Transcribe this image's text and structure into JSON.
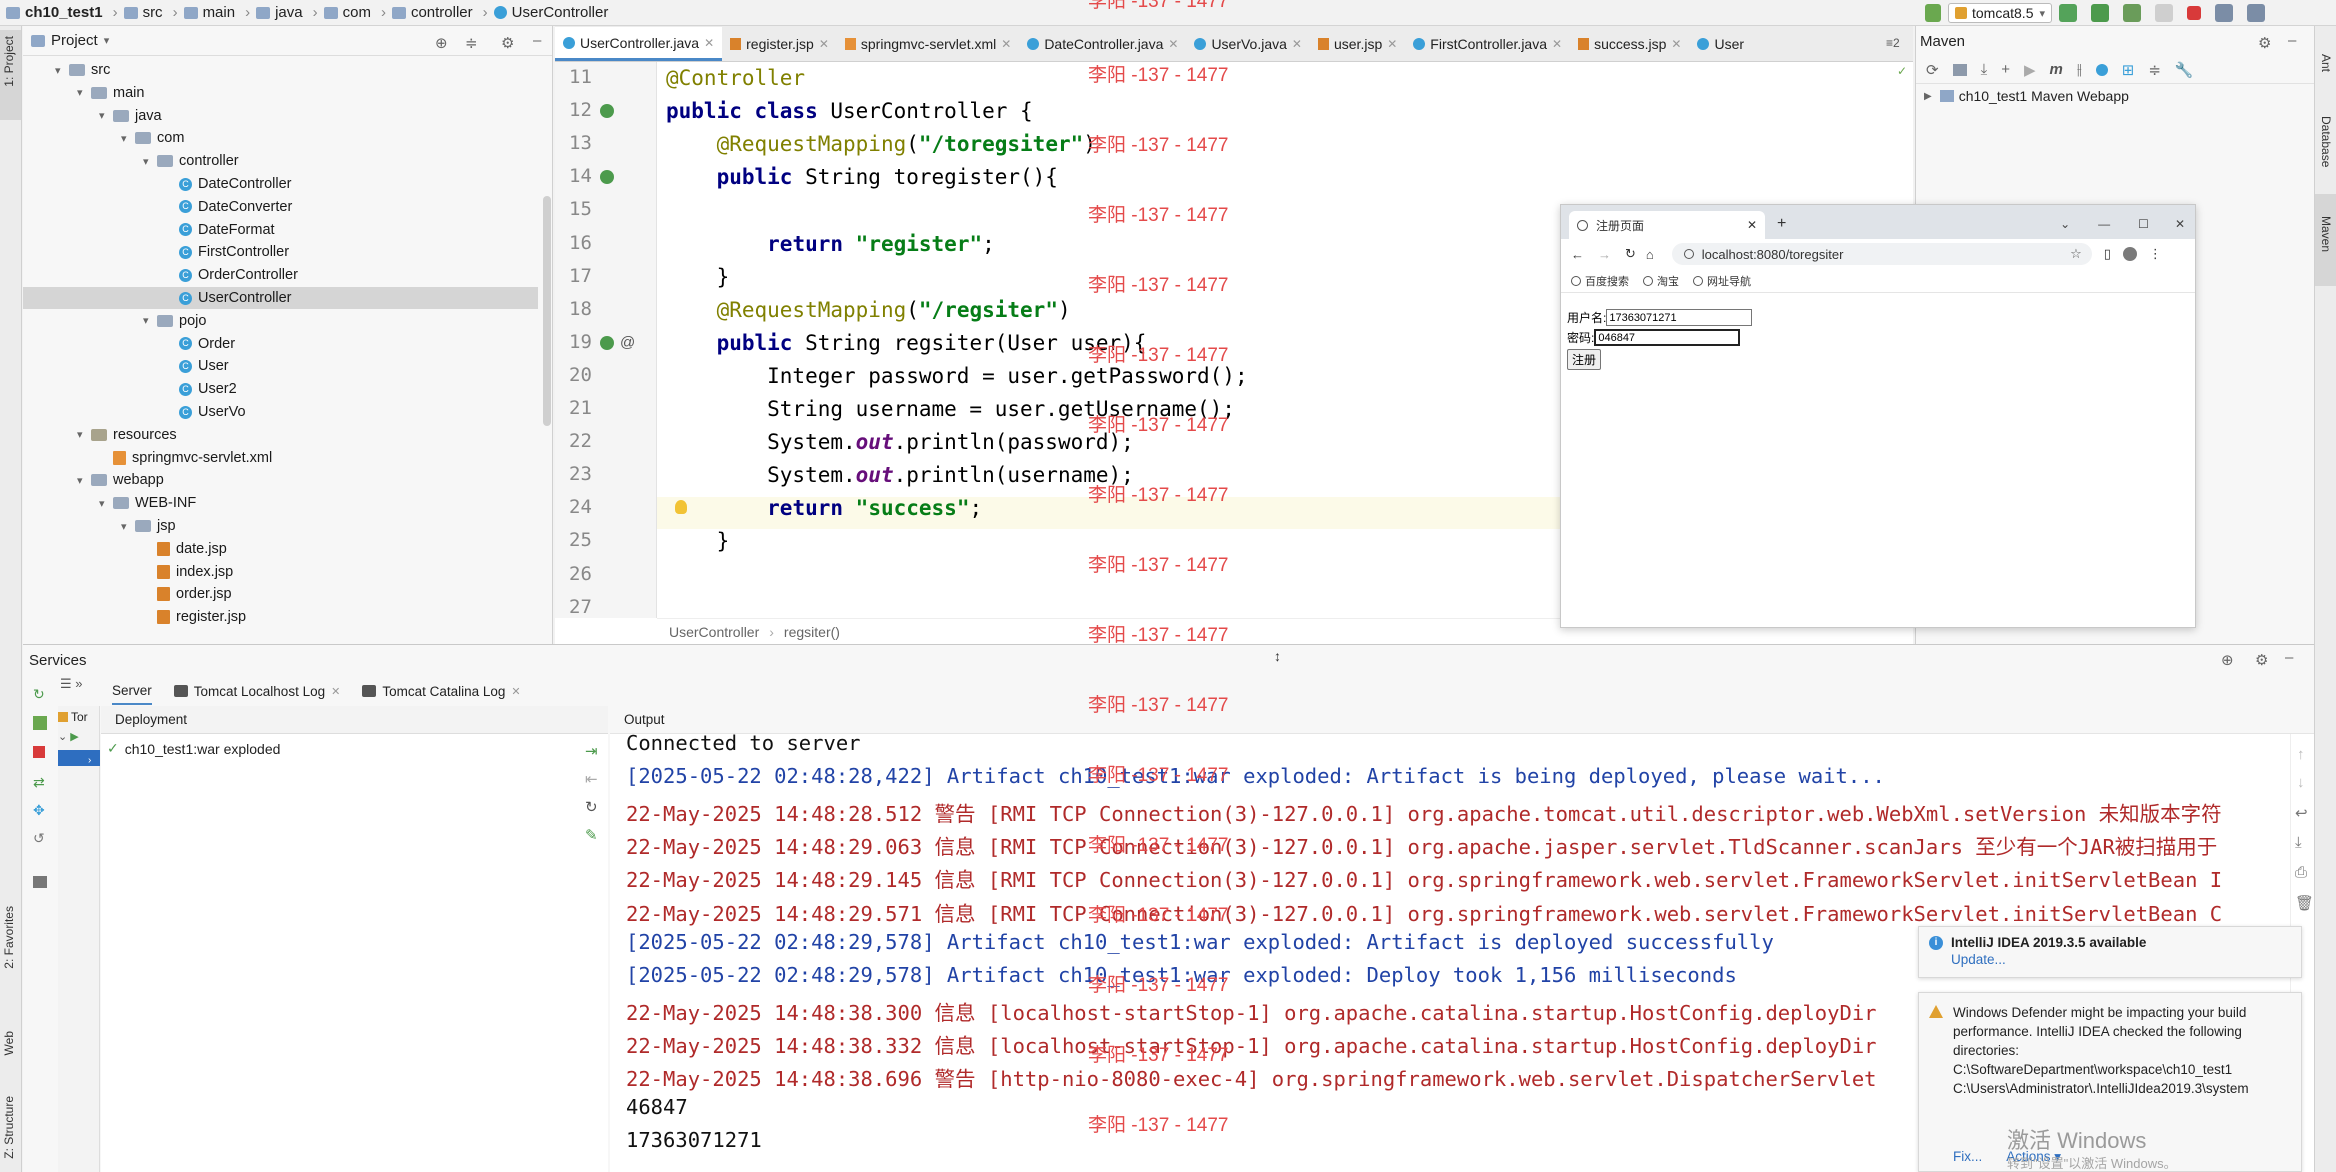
{
  "navbar": {
    "breadcrumbs": [
      "ch10_test1",
      "src",
      "main",
      "java",
      "com",
      "controller",
      "UserController"
    ],
    "run_config": "tomcat8.5"
  },
  "project_panel": {
    "title": "Project",
    "tree": [
      {
        "label": "src",
        "depth": 1,
        "kind": "folder",
        "arrow": "▾"
      },
      {
        "label": "main",
        "depth": 2,
        "kind": "folder",
        "arrow": "▾"
      },
      {
        "label": "java",
        "depth": 3,
        "kind": "folder",
        "arrow": "▾"
      },
      {
        "label": "com",
        "depth": 4,
        "kind": "folder",
        "arrow": "▾"
      },
      {
        "label": "controller",
        "depth": 5,
        "kind": "folder",
        "arrow": "▾"
      },
      {
        "label": "DateController",
        "depth": 6,
        "kind": "class"
      },
      {
        "label": "DateConverter",
        "depth": 6,
        "kind": "class"
      },
      {
        "label": "DateFormat",
        "depth": 6,
        "kind": "class"
      },
      {
        "label": "FirstController",
        "depth": 6,
        "kind": "class"
      },
      {
        "label": "OrderController",
        "depth": 6,
        "kind": "class"
      },
      {
        "label": "UserController",
        "depth": 6,
        "kind": "class",
        "selected": true
      },
      {
        "label": "pojo",
        "depth": 5,
        "kind": "folder",
        "arrow": "▾"
      },
      {
        "label": "Order",
        "depth": 6,
        "kind": "class"
      },
      {
        "label": "User",
        "depth": 6,
        "kind": "class"
      },
      {
        "label": "User2",
        "depth": 6,
        "kind": "class"
      },
      {
        "label": "UserVo",
        "depth": 6,
        "kind": "class"
      },
      {
        "label": "resources",
        "depth": 2,
        "kind": "folder-res",
        "arrow": "▾"
      },
      {
        "label": "springmvc-servlet.xml",
        "depth": 3,
        "kind": "xml"
      },
      {
        "label": "webapp",
        "depth": 2,
        "kind": "folder",
        "arrow": "▾"
      },
      {
        "label": "WEB-INF",
        "depth": 3,
        "kind": "folder",
        "arrow": "▾"
      },
      {
        "label": "jsp",
        "depth": 4,
        "kind": "folder",
        "arrow": "▾"
      },
      {
        "label": "date.jsp",
        "depth": 5,
        "kind": "jsp"
      },
      {
        "label": "index.jsp",
        "depth": 5,
        "kind": "jsp"
      },
      {
        "label": "order.jsp",
        "depth": 5,
        "kind": "jsp"
      },
      {
        "label": "register.jsp",
        "depth": 5,
        "kind": "jsp"
      }
    ]
  },
  "editor": {
    "tabs": [
      {
        "label": "UserController.java",
        "icon": "class",
        "active": true
      },
      {
        "label": "register.jsp",
        "icon": "jsp"
      },
      {
        "label": "springmvc-servlet.xml",
        "icon": "xml"
      },
      {
        "label": "DateController.java",
        "icon": "class"
      },
      {
        "label": "UserVo.java",
        "icon": "class"
      },
      {
        "label": "user.jsp",
        "icon": "jsp"
      },
      {
        "label": "FirstController.java",
        "icon": "class"
      },
      {
        "label": "success.jsp",
        "icon": "jsp"
      },
      {
        "label": "User",
        "icon": "class"
      }
    ],
    "tab_overflow": "≡2",
    "lines": [
      {
        "num": "11",
        "html": "<span class='ann'>@Controller</span>"
      },
      {
        "num": "12",
        "html": "<span class='kw'>public class</span> UserController {"
      },
      {
        "num": "13",
        "html": "    <span class='ann'>@RequestMapping</span>(<span class='str'>\"/toregsiter\"</span>)"
      },
      {
        "num": "14",
        "html": "    <span class='kw'>public</span> String toregister(){"
      },
      {
        "num": "15",
        "html": ""
      },
      {
        "num": "16",
        "html": "        <span class='kw'>return</span> <span class='str'>\"register\"</span>;"
      },
      {
        "num": "17",
        "html": "    }"
      },
      {
        "num": "18",
        "html": "    <span class='ann'>@RequestMapping</span>(<span class='str'>\"/regsiter\"</span>)"
      },
      {
        "num": "19",
        "html": "    <span class='kw'>public</span> String regsiter(User user){"
      },
      {
        "num": "20",
        "html": "        Integer password = user.getPassword();"
      },
      {
        "num": "21",
        "html": "        String username = user.getUsername();"
      },
      {
        "num": "22",
        "html": "        System.<span class='ital'>out</span>.println(password);"
      },
      {
        "num": "23",
        "html": "        System.<span class='ital'>out</span>.println(username);"
      },
      {
        "num": "24",
        "html": "        <span class='kw'>return</span> <span class='str'>\"success\"</span>;"
      },
      {
        "num": "25",
        "html": "    }"
      },
      {
        "num": "26",
        "html": ""
      },
      {
        "num": "27",
        "html": ""
      }
    ],
    "footer_breadcrumb": [
      "UserController",
      "regsiter()"
    ]
  },
  "maven": {
    "title": "Maven",
    "project": "ch10_test1 Maven Webapp"
  },
  "browser": {
    "tab_title": "注册页面",
    "url": "localhost:8080/toregsiter",
    "bookmarks": [
      "百度搜索",
      "淘宝",
      "网址导航"
    ],
    "username_label": "用户名:",
    "username_value": "17363071271",
    "password_label": "密码:",
    "password_value": "046847",
    "submit_label": "注册"
  },
  "services": {
    "title": "Services",
    "tabs": [
      "Server",
      "Tomcat Localhost Log",
      "Tomcat Catalina Log"
    ],
    "tree_root": "Tor",
    "deployment_header": "Deployment",
    "deployment_item": "ch10_test1:war exploded",
    "output_header": "Output",
    "output_lines": [
      {
        "text": "Connected to server",
        "style": "plain"
      },
      {
        "text": "[2025-05-22 02:48:28,422] Artifact ch10_test1:war exploded: Artifact is being deployed, please wait...",
        "style": "blue"
      },
      {
        "text": "22-May-2025 14:48:28.512 警告 [RMI TCP Connection(3)-127.0.0.1] org.apache.tomcat.util.descriptor.web.WebXml.setVersion 未知版本字符",
        "style": "red"
      },
      {
        "text": "22-May-2025 14:48:29.063 信息 [RMI TCP Connection(3)-127.0.0.1] org.apache.jasper.servlet.TldScanner.scanJars 至少有一个JAR被扫描用于",
        "style": "red"
      },
      {
        "text": "22-May-2025 14:48:29.145 信息 [RMI TCP Connection(3)-127.0.0.1] org.springframework.web.servlet.FrameworkServlet.initServletBean I",
        "style": "red"
      },
      {
        "text": "22-May-2025 14:48:29.571 信息 [RMI TCP Connection(3)-127.0.0.1] org.springframework.web.servlet.FrameworkServlet.initServletBean C",
        "style": "red"
      },
      {
        "text": "[2025-05-22 02:48:29,578] Artifact ch10_test1:war exploded: Artifact is deployed successfully",
        "style": "blue"
      },
      {
        "text": "[2025-05-22 02:48:29,578] Artifact ch10_test1:war exploded: Deploy took 1,156 milliseconds",
        "style": "blue"
      },
      {
        "text": "22-May-2025 14:48:38.300 信息 [localhost-startStop-1] org.apache.catalina.startup.HostConfig.deployDir",
        "style": "red"
      },
      {
        "text": "22-May-2025 14:48:38.332 信息 [localhost-startStop-1] org.apache.catalina.startup.HostConfig.deployDir",
        "style": "red"
      },
      {
        "text": "22-May-2025 14:48:38.696 警告 [http-nio-8080-exec-4] org.springframework.web.servlet.DispatcherServlet",
        "style": "red"
      },
      {
        "text": "46847",
        "style": "plain"
      },
      {
        "text": "17363071271",
        "style": "plain"
      }
    ]
  },
  "notifications": {
    "update_title": "IntelliJ IDEA 2019.3.5 available",
    "update_link": "Update...",
    "defender_text": "Windows Defender might be impacting your build performance. IntelliJ IDEA checked the following directories:",
    "defender_dirs": [
      "C:\\SoftwareDepartment\\workspace\\ch10_test1",
      "C:\\Users\\Administrator\\.IntelliJIdea2019.3\\system"
    ],
    "fix_link": "Fix...",
    "actions_link": "Actions ▾",
    "activation_title": "激活 Windows",
    "activation_sub": "转到\"设置\"以激活 Windows。"
  },
  "left_stripe": [
    "1: Project",
    "2: Favorites",
    "Web",
    "Z: Structure"
  ],
  "right_stripe": [
    "Ant",
    "Database",
    "Maven"
  ],
  "watermark": "李阳 -137 - 1477",
  "colors": {
    "accent": "#4a88c7",
    "watermark": "#e44a4a",
    "log_red": "#b02a2a",
    "log_blue": "#2143a6",
    "string_green": "#067d17",
    "keyword_navy": "#000080",
    "annotation_olive": "#808000"
  }
}
